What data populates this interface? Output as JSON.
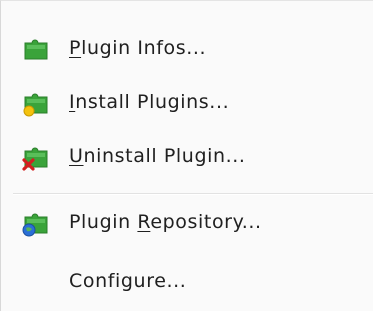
{
  "menu": {
    "items": [
      {
        "pre": "",
        "mn": "P",
        "post": "lugin Infos...",
        "icon": "puzzle-icon"
      },
      {
        "pre": "",
        "mn": "I",
        "post": "nstall Plugins...",
        "icon": "puzzle-install-icon"
      },
      {
        "pre": "",
        "mn": "U",
        "post": "ninstall Plugin...",
        "icon": "puzzle-uninstall-icon"
      },
      {
        "pre": "Plugin ",
        "mn": "R",
        "post": "epository...",
        "icon": "puzzle-globe-icon"
      },
      {
        "pre": "Configure...",
        "mn": "",
        "post": "",
        "icon": ""
      }
    ]
  },
  "colors": {
    "puzzle_green": "#3aa33a",
    "install_yellow": "#f4c20d",
    "uninstall_red": "#d32020",
    "globe_blue": "#2a6fd6"
  }
}
